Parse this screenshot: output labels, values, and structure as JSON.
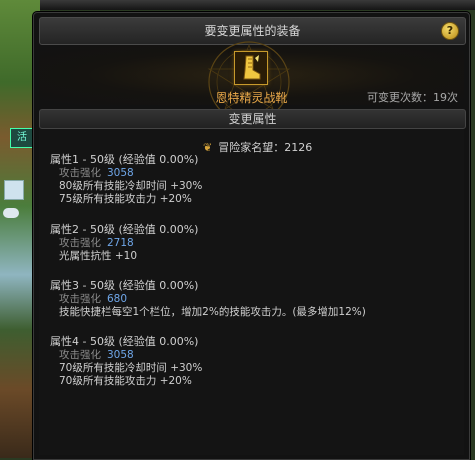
{
  "background": {
    "chip_label": "活"
  },
  "window": {
    "title": "要变更属性的装备",
    "help_label": "?"
  },
  "equipment": {
    "name": "恩特精灵战靴",
    "change_count": "可变更次数：19次",
    "icon": "boot-icon"
  },
  "section": {
    "title": "变更属性"
  },
  "fame": {
    "label": "冒险家名望：2126",
    "icon": "medal-icon"
  },
  "attributes": [
    {
      "title": "属性1 - 50级 (经验值 0.00%)",
      "enhance_label": "攻击强化",
      "enhance_value": "3058",
      "effects": [
        "80级所有技能冷却时间 +30%",
        "75级所有技能攻击力 +20%"
      ]
    },
    {
      "title": "属性2 - 50级 (经验值 0.00%)",
      "enhance_label": "攻击强化",
      "enhance_value": "2718",
      "effects": [
        "光属性抗性 +10"
      ]
    },
    {
      "title": "属性3 - 50级 (经验值 0.00%)",
      "enhance_label": "攻击强化",
      "enhance_value": "680",
      "effects": [
        "技能快捷栏每空1个栏位，增加2%的技能攻击力。(最多增加12%)"
      ]
    },
    {
      "title": "属性4 - 50级 (经验值 0.00%)",
      "enhance_label": "攻击强化",
      "enhance_value": "3058",
      "effects": [
        "70级所有技能冷却时间 +30%",
        "70级所有技能攻击力 +20%"
      ]
    }
  ],
  "colors": {
    "item_name": "#e8a84a",
    "enhance_value": "#6fa6e8",
    "gold_border": "#c79a2c"
  }
}
